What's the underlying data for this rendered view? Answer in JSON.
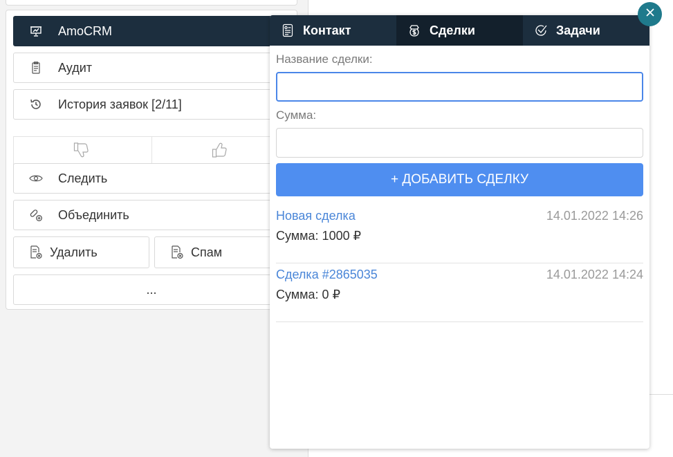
{
  "menu": {
    "amocrm": "AmoCRM",
    "audit": "Аудит",
    "history": "История заявок [2/11]",
    "follow": "Следить",
    "merge": "Объединить",
    "delete": "Удалить",
    "spam": "Спам",
    "more": "..."
  },
  "tabs": {
    "contact": "Контакт",
    "deals": "Сделки",
    "tasks": "Задачи"
  },
  "form": {
    "deal_name_label": "Название сделки:",
    "deal_name_value": "",
    "sum_label": "Сумма:",
    "sum_value": "",
    "add_button": "+ ДОБАВИТЬ СДЕЛКУ"
  },
  "deals": [
    {
      "name": "Новая сделка",
      "date": "14.01.2022 14:26",
      "sum": "Сумма: 1000 ₽"
    },
    {
      "name": "Сделка #2865035",
      "date": "14.01.2022 14:24",
      "sum": "Сумма: 0 ₽"
    }
  ],
  "colors": {
    "dark_header": "#1c2e3e",
    "accent_blue": "#4f8ef0",
    "link_blue": "#4a86d8",
    "close_teal": "#1f7a8c"
  },
  "icons": {
    "amocrm": "presentation-board-icon",
    "audit": "clipboard-icon",
    "history": "history-icon",
    "dislike": "thumbs-down-icon",
    "like": "thumbs-up-icon",
    "follow": "eye-icon",
    "merge": "link-plus-icon",
    "delete": "document-delete-icon",
    "spam": "document-spam-icon",
    "contact": "contact-card-icon",
    "deals": "dollar-icon",
    "tasks": "check-circle-icon",
    "close": "close-icon"
  }
}
